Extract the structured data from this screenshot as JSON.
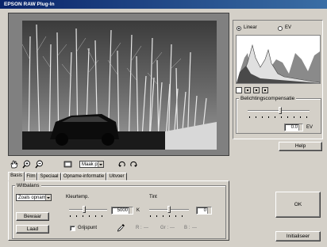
{
  "window": {
    "title": "EPSON RAW Plug-In"
  },
  "mode": {
    "linear_label": "Linear",
    "ev_label": "EV",
    "selected": "Linear"
  },
  "exposure": {
    "group_label": "Belichtingscompensatie",
    "value": "0.0",
    "unit": "EV"
  },
  "help_button": "Help",
  "toolbar": {
    "zoom_select": "Maak p"
  },
  "tabs": [
    "Basis",
    "Film",
    "Speciaal",
    "Opname-informatie",
    "Uitvoer"
  ],
  "white_balance": {
    "group_label": "Witbalans",
    "preset": "Zoals opname",
    "save_button": "Bewaar",
    "load_button": "Laad",
    "color_temp_label": "Kleurtemp.",
    "color_temp_value": "5000",
    "color_temp_unit": "K",
    "tint_label": "Tint",
    "tint_value": "0",
    "gray_point_label": "Grijspunt",
    "r_label": "R :",
    "r_value": "---",
    "g_label": "Gr :",
    "g_value": "---",
    "b_label": "B :",
    "b_value": "---"
  },
  "ok_button": "OK",
  "reset_button": "Initialiseer"
}
